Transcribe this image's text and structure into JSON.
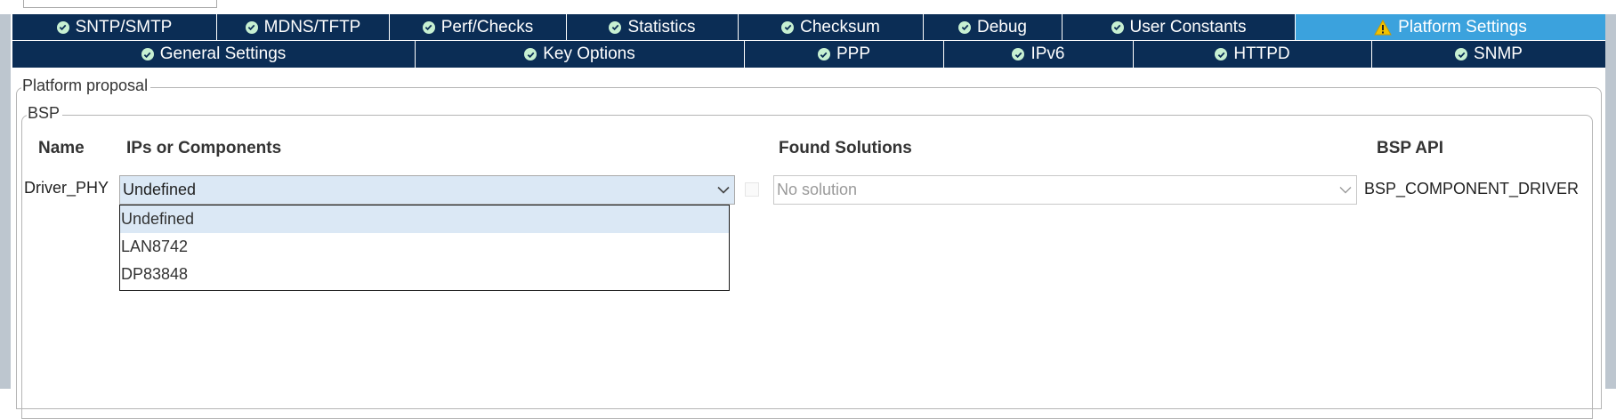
{
  "tabs_row1": [
    {
      "label": "SNTP/SMTP",
      "icon": "check-circle-icon",
      "status": "ok"
    },
    {
      "label": "MDNS/TFTP",
      "icon": "check-circle-icon",
      "status": "ok"
    },
    {
      "label": "Perf/Checks",
      "icon": "check-circle-icon",
      "status": "ok"
    },
    {
      "label": "Statistics",
      "icon": "check-circle-icon",
      "status": "ok"
    },
    {
      "label": "Checksum",
      "icon": "check-circle-icon",
      "status": "ok"
    },
    {
      "label": "Debug",
      "icon": "check-circle-icon",
      "status": "ok"
    },
    {
      "label": "User Constants",
      "icon": "check-circle-icon",
      "status": "ok"
    },
    {
      "label": "Platform Settings",
      "icon": "warning-icon",
      "status": "warning",
      "active": true
    }
  ],
  "tabs_row2": [
    {
      "label": "General Settings",
      "icon": "check-circle-icon"
    },
    {
      "label": "Key Options",
      "icon": "check-circle-icon"
    },
    {
      "label": "PPP",
      "icon": "check-circle-icon"
    },
    {
      "label": "IPv6",
      "icon": "check-circle-icon"
    },
    {
      "label": "HTTPD",
      "icon": "check-circle-icon"
    },
    {
      "label": "SNMP",
      "icon": "check-circle-icon"
    }
  ],
  "colors": {
    "tab_bg": "#0b2d55",
    "tab_active_bg": "#3ba2dd",
    "ok_icon": "#2fb35a",
    "warning_icon": "#f2c200",
    "selection_bg": "#dbe8f5"
  },
  "platform_proposal": {
    "legend": "Platform proposal",
    "bsp": {
      "legend": "BSP",
      "headers": {
        "name": "Name",
        "ips": "IPs or Components",
        "solutions": "Found Solutions",
        "api": "BSP API"
      },
      "row": {
        "name": "Driver_PHY",
        "ip_value": "Undefined",
        "solution_value": "No solution",
        "api": "BSP_COMPONENT_DRIVER"
      },
      "dropdown_options": [
        "Undefined",
        "LAN8742",
        "DP83848"
      ]
    }
  }
}
